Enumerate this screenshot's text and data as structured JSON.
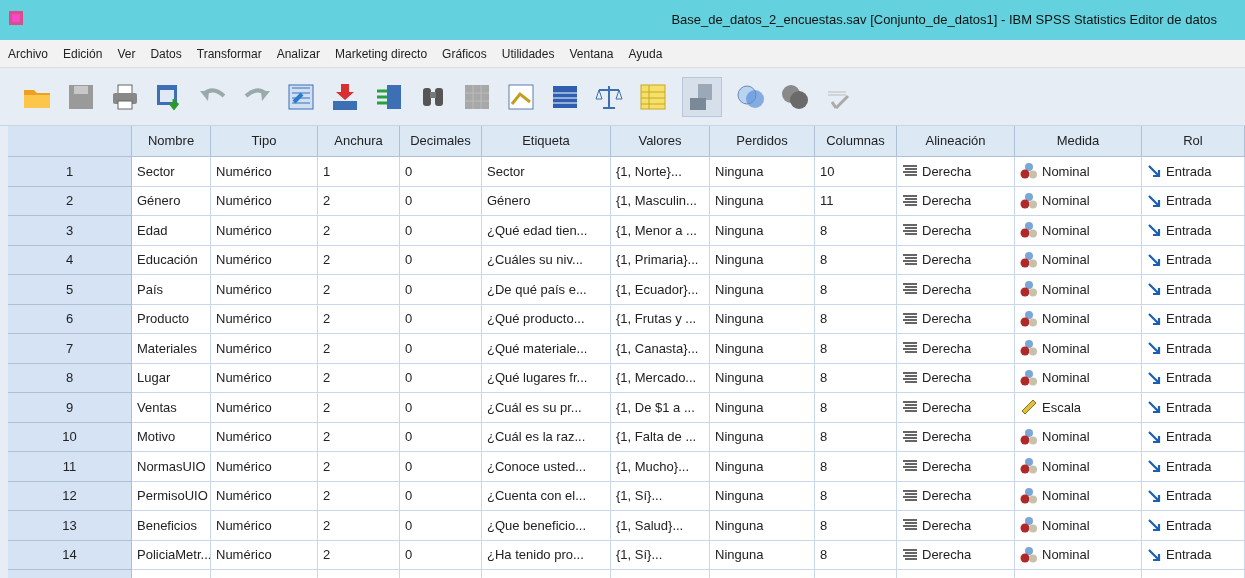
{
  "window": {
    "title": "Base_de_datos_2_encuestas.sav [Conjunto_de_datos1] - IBM SPSS Statistics Editor de datos"
  },
  "menu": [
    "Archivo",
    "Edición",
    "Ver",
    "Datos",
    "Transformar",
    "Analizar",
    "Marketing directo",
    "Gráficos",
    "Utilidades",
    "Ventana",
    "Ayuda"
  ],
  "table": {
    "columns": [
      "Nombre",
      "Tipo",
      "Anchura",
      "Decimales",
      "Etiqueta",
      "Valores",
      "Perdidos",
      "Columnas",
      "Alineación",
      "Medida",
      "Rol"
    ],
    "rows": [
      {
        "number": "1",
        "cells": [
          "Sector",
          "Numérico",
          "1",
          "0",
          "Sector",
          "{1, Norte}...",
          "Ninguna",
          "10",
          "Derecha"
        ],
        "measure": {
          "kind": "nominal",
          "label": "Nominal"
        },
        "role": "Entrada"
      },
      {
        "number": "2",
        "cells": [
          "Género",
          "Numérico",
          "2",
          "0",
          "Género",
          "{1, Masculin...",
          "Ninguna",
          "11",
          "Derecha"
        ],
        "measure": {
          "kind": "nominal",
          "label": "Nominal"
        },
        "role": "Entrada"
      },
      {
        "number": "3",
        "cells": [
          "Edad",
          "Numérico",
          "2",
          "0",
          "¿Qué edad tien...",
          "{1, Menor a ...",
          "Ninguna",
          "8",
          "Derecha"
        ],
        "measure": {
          "kind": "nominal",
          "label": "Nominal"
        },
        "role": "Entrada"
      },
      {
        "number": "4",
        "cells": [
          "Educación",
          "Numérico",
          "2",
          "0",
          "¿Cuáles su niv...",
          "{1, Primaria}...",
          "Ninguna",
          "8",
          "Derecha"
        ],
        "measure": {
          "kind": "nominal",
          "label": "Nominal"
        },
        "role": "Entrada"
      },
      {
        "number": "5",
        "cells": [
          "País",
          "Numérico",
          "2",
          "0",
          "¿De qué país e...",
          "{1, Ecuador}...",
          "Ninguna",
          "8",
          "Derecha"
        ],
        "measure": {
          "kind": "nominal",
          "label": "Nominal"
        },
        "role": "Entrada"
      },
      {
        "number": "6",
        "cells": [
          "Producto",
          "Numérico",
          "2",
          "0",
          "¿Qué producto...",
          "{1, Frutas y ...",
          "Ninguna",
          "8",
          "Derecha"
        ],
        "measure": {
          "kind": "nominal",
          "label": "Nominal"
        },
        "role": "Entrada"
      },
      {
        "number": "7",
        "cells": [
          "Materiales",
          "Numérico",
          "2",
          "0",
          "¿Qué materiale...",
          "{1, Canasta}...",
          "Ninguna",
          "8",
          "Derecha"
        ],
        "measure": {
          "kind": "nominal",
          "label": "Nominal"
        },
        "role": "Entrada"
      },
      {
        "number": "8",
        "cells": [
          "Lugar",
          "Numérico",
          "2",
          "0",
          "¿Qué lugares fr...",
          "{1, Mercado...",
          "Ninguna",
          "8",
          "Derecha"
        ],
        "measure": {
          "kind": "nominal",
          "label": "Nominal"
        },
        "role": "Entrada"
      },
      {
        "number": "9",
        "cells": [
          "Ventas",
          "Numérico",
          "2",
          "0",
          "¿Cuál es su pr...",
          "{1, De $1 a ...",
          "Ninguna",
          "8",
          "Derecha"
        ],
        "measure": {
          "kind": "scale",
          "label": "Escala"
        },
        "role": "Entrada"
      },
      {
        "number": "10",
        "cells": [
          "Motivo",
          "Numérico",
          "2",
          "0",
          "¿Cuál es la raz...",
          "{1, Falta de ...",
          "Ninguna",
          "8",
          "Derecha"
        ],
        "measure": {
          "kind": "nominal",
          "label": "Nominal"
        },
        "role": "Entrada"
      },
      {
        "number": "11",
        "cells": [
          "NormasUIO",
          "Numérico",
          "2",
          "0",
          "¿Conoce usted...",
          "{1, Mucho}...",
          "Ninguna",
          "8",
          "Derecha"
        ],
        "measure": {
          "kind": "nominal",
          "label": "Nominal"
        },
        "role": "Entrada"
      },
      {
        "number": "12",
        "cells": [
          "PermisoUIO",
          "Numérico",
          "2",
          "0",
          "¿Cuenta con el...",
          "{1, Sí}...",
          "Ninguna",
          "8",
          "Derecha"
        ],
        "measure": {
          "kind": "nominal",
          "label": "Nominal"
        },
        "role": "Entrada"
      },
      {
        "number": "13",
        "cells": [
          "Beneficios",
          "Numérico",
          "2",
          "0",
          "¿Que beneficio...",
          "{1, Salud}...",
          "Ninguna",
          "8",
          "Derecha"
        ],
        "measure": {
          "kind": "nominal",
          "label": "Nominal"
        },
        "role": "Entrada"
      },
      {
        "number": "14",
        "cells": [
          "PoliciaMetr...",
          "Numérico",
          "2",
          "0",
          "¿Ha tenido pro...",
          "{1, Sí}...",
          "Ninguna",
          "8",
          "Derecha"
        ],
        "measure": {
          "kind": "nominal",
          "label": "Nominal"
        },
        "role": "Entrada"
      }
    ]
  }
}
